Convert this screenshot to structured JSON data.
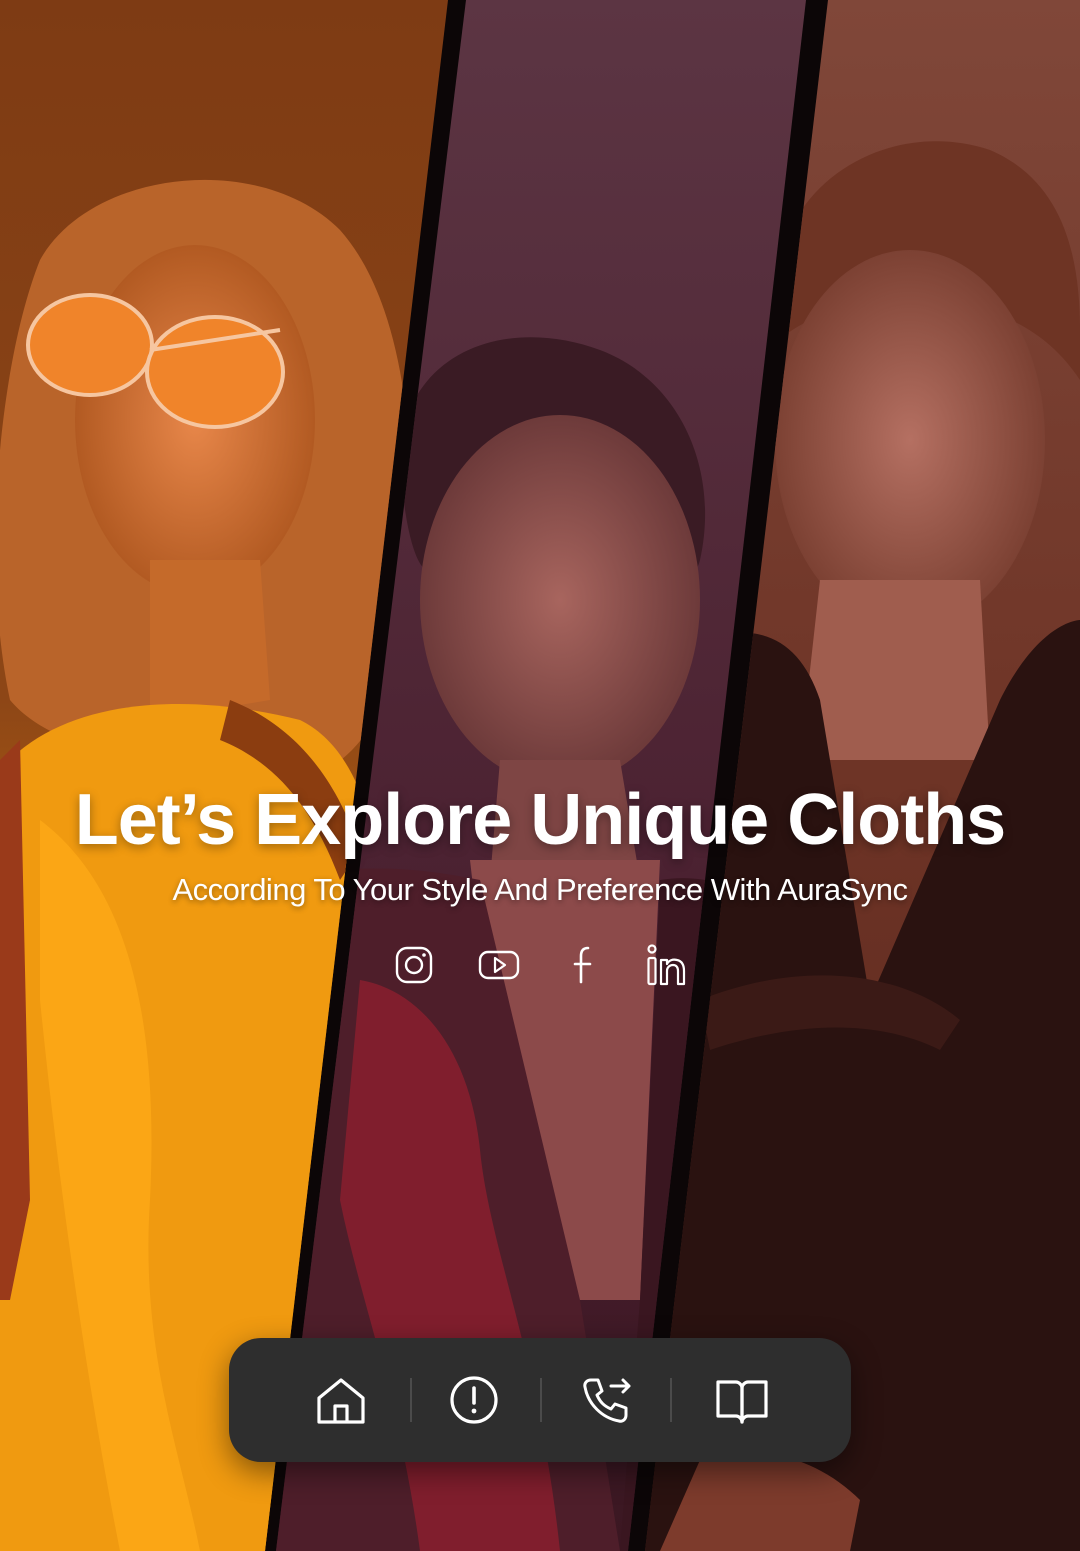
{
  "hero": {
    "title": "Let’s Explore Unique Cloths",
    "subtitle": "According To Your Style And Preference With AuraSync"
  },
  "social_links": [
    {
      "name": "instagram",
      "icon": "instagram-icon"
    },
    {
      "name": "youtube",
      "icon": "youtube-icon"
    },
    {
      "name": "facebook",
      "icon": "facebook-icon"
    },
    {
      "name": "linkedin",
      "icon": "linkedin-icon"
    }
  ],
  "nav": [
    {
      "name": "home",
      "icon": "home-icon"
    },
    {
      "name": "about",
      "icon": "info-icon"
    },
    {
      "name": "contact",
      "icon": "phone-icon"
    },
    {
      "name": "catalog",
      "icon": "book-icon"
    }
  ],
  "colors": {
    "left_panel": "#7a3a12",
    "middle_panel": "#5b3340",
    "right_panel": "#7a4638",
    "navbar": "#2e2e2e",
    "text": "#ffffff"
  }
}
